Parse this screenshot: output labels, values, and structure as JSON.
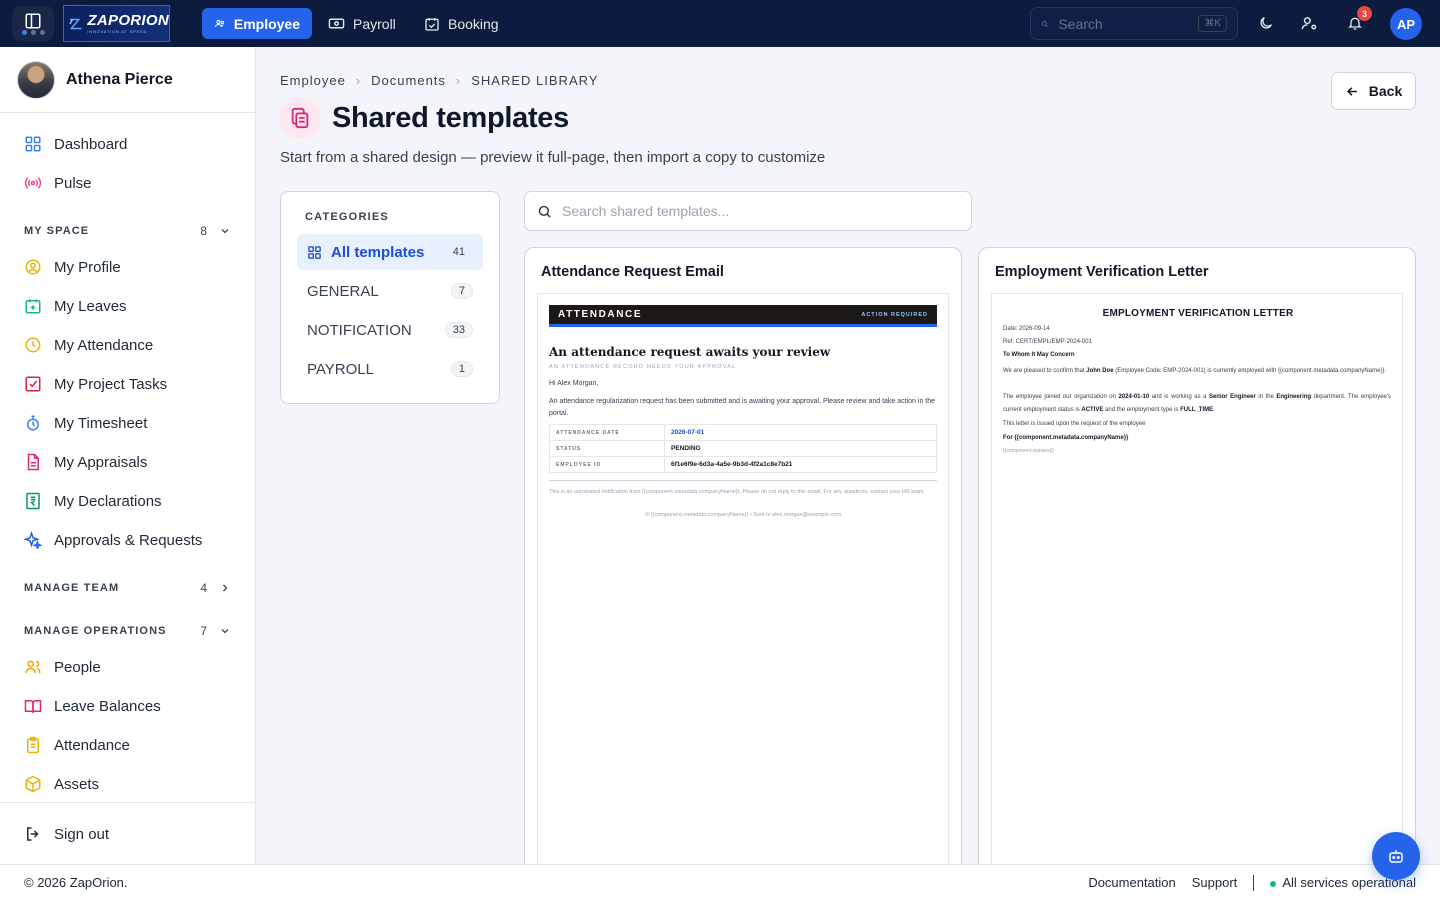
{
  "topbar": {
    "logo_name": "ZAPORION",
    "logo_tagline": "INNOVATION AT SPEED",
    "tabs": [
      {
        "label": "Employee",
        "icon": "users-icon",
        "active": true
      },
      {
        "label": "Payroll",
        "icon": "cash-icon",
        "active": false
      },
      {
        "label": "Booking",
        "icon": "calendar-check-icon",
        "active": false
      }
    ],
    "search_placeholder": "Search",
    "search_shortcut": "⌘K",
    "notification_count": "3",
    "avatar_initials": "AP"
  },
  "sidebar": {
    "user_name": "Athena Pierce",
    "top_items": [
      {
        "label": "Dashboard",
        "icon": "dashboard-icon"
      },
      {
        "label": "Pulse",
        "icon": "broadcast-icon"
      }
    ],
    "sections": [
      {
        "title": "MY SPACE",
        "count": "8",
        "expanded": true,
        "items": [
          {
            "label": "My Profile",
            "icon": "user-circle-icon"
          },
          {
            "label": "My Leaves",
            "icon": "calendar-plus-icon"
          },
          {
            "label": "My Attendance",
            "icon": "clock-icon"
          },
          {
            "label": "My Project Tasks",
            "icon": "task-check-icon"
          },
          {
            "label": "My Timesheet",
            "icon": "stopwatch-icon"
          },
          {
            "label": "My Appraisals",
            "icon": "document-icon"
          },
          {
            "label": "My Declarations",
            "icon": "rupee-receipt-icon"
          },
          {
            "label": "Approvals & Requests",
            "icon": "sparkle-icon"
          }
        ]
      },
      {
        "title": "MANAGE TEAM",
        "count": "4",
        "expanded": false,
        "items": []
      },
      {
        "title": "MANAGE OPERATIONS",
        "count": "7",
        "expanded": true,
        "items": [
          {
            "label": "People",
            "icon": "people-icon"
          },
          {
            "label": "Leave Balances",
            "icon": "book-open-icon"
          },
          {
            "label": "Attendance",
            "icon": "clipboard-icon"
          },
          {
            "label": "Assets",
            "icon": "box-icon"
          }
        ]
      }
    ],
    "sign_out": "Sign out"
  },
  "main": {
    "breadcrumb": [
      "Employee",
      "Documents",
      "SHARED LIBRARY"
    ],
    "title": "Shared templates",
    "subtitle": "Start from a shared design — preview it full-page, then import a copy to customize",
    "back_label": "Back",
    "categories_heading": "CATEGORIES",
    "categories": [
      {
        "label": "All templates",
        "count": "41",
        "active": true
      },
      {
        "label": "GENERAL",
        "count": "7",
        "active": false
      },
      {
        "label": "NOTIFICATION",
        "count": "33",
        "active": false
      },
      {
        "label": "PAYROLL",
        "count": "1",
        "active": false
      }
    ],
    "search_placeholder": "Search shared templates...",
    "cards": [
      {
        "title": "Attendance Request Email",
        "preview": {
          "header": "ATTENDANCE",
          "header_tag": "ACTION REQUIRED",
          "heading": "An attendance request awaits your review",
          "subheading": "AN ATTENDANCE RECORD NEEDS YOUR APPROVAL",
          "greeting": "Hi Alex Morgan,",
          "body": "An attendance regularization request has been submitted and is awaiting your approval. Please review and take action in the portal.",
          "rows": [
            {
              "key": "ATTENDANCE DATE",
              "value": "2026-07-01"
            },
            {
              "key": "STATUS",
              "value": "PENDING"
            },
            {
              "key": "EMPLOYEE ID",
              "value": "6f1e6f9e-6d3a-4a5e-9b3d-4f2a1c8e7b21"
            }
          ],
          "footer_note": "This is an automated notification from {{component.metadata.companyName}}. Please do not reply to this email. For any questions, contact your HR team.",
          "footer_copy": "© {{component.metadata.companyName}}  •  Sent to alex.morgan@example.com"
        }
      },
      {
        "title": "Employment Verification Letter",
        "preview": {
          "heading": "EMPLOYMENT VERIFICATION LETTER",
          "date": "Date: 2026-09-14",
          "ref": "Ref: CERT/EMPL/EMP-2024-001",
          "salutation": "To Whom It May Concern",
          "p1_a": "We are pleased to confirm that ",
          "p1_name": "John Doe",
          "p1_b": " (Employee Code: EMP-2024-001) is currently employed with {{component.metadata.companyName}}.",
          "p2_a": "The employee joined our organization on ",
          "p2_date": "2024-01-10",
          "p2_b": " and is working as a ",
          "p2_role": "Senior Engineer",
          "p2_c": " in the ",
          "p2_dept": "Engineering",
          "p2_d": " department. The employee's current employment status is ",
          "p2_status": "ACTIVE",
          "p2_e": " and the employment type is ",
          "p2_type": "FULL_TIME",
          "p2_f": ".",
          "p3": "This letter is issued upon the request of the employee",
          "sign_for": "For {{component.metadata.companyName}}",
          "sign_seal": "{{component.signseal}}"
        }
      }
    ]
  },
  "footer": {
    "copyright": "© 2026 ZapOrion.",
    "links": [
      "Documentation",
      "Support"
    ],
    "status": "All services operational"
  },
  "colors": {
    "topbar_bg": "#0d1b3e",
    "accent": "#2563eb",
    "title_icon_bg": "#fde8ef",
    "status_ok": "#10b981"
  }
}
